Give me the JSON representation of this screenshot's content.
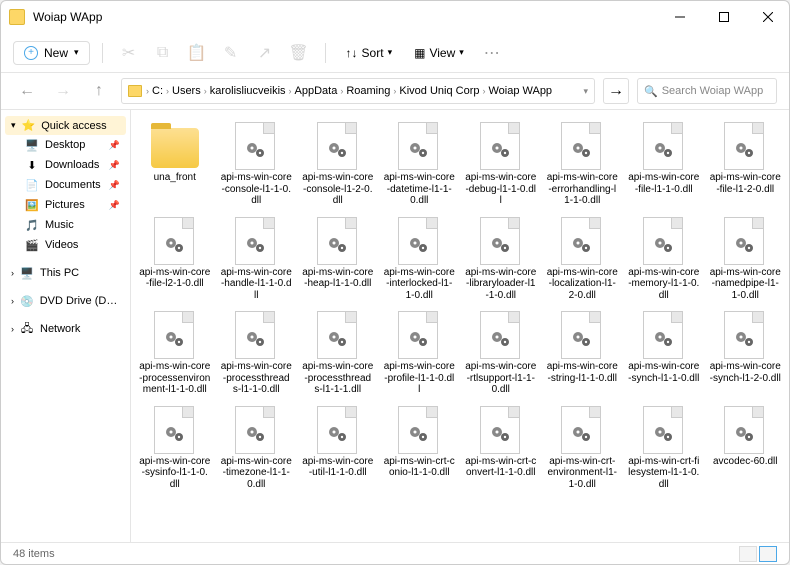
{
  "window": {
    "title": "Woiap WApp"
  },
  "toolbar": {
    "new_label": "New",
    "sort_label": "Sort",
    "view_label": "View"
  },
  "breadcrumbs": [
    "C:",
    "Users",
    "karolisliucveikis",
    "AppData",
    "Roaming",
    "Kivod Uniq Corp",
    "Woiap WApp"
  ],
  "search": {
    "placeholder": "Search Woiap WApp"
  },
  "sidebar": {
    "quick": "Quick access",
    "items": [
      {
        "label": "Desktop",
        "icon": "🖥️",
        "pinned": true
      },
      {
        "label": "Downloads",
        "icon": "⬇",
        "pinned": true
      },
      {
        "label": "Documents",
        "icon": "📄",
        "pinned": true
      },
      {
        "label": "Pictures",
        "icon": "🖼️",
        "pinned": true
      },
      {
        "label": "Music",
        "icon": "🎵",
        "pinned": false
      },
      {
        "label": "Videos",
        "icon": "🎬",
        "pinned": false
      }
    ],
    "thispc": "This PC",
    "dvd": "DVD Drive (D:) CCCC",
    "network": "Network"
  },
  "files": [
    {
      "name": "una_front",
      "type": "folder"
    },
    {
      "name": "api-ms-win-core-console-l1-1-0.dll",
      "type": "dll"
    },
    {
      "name": "api-ms-win-core-console-l1-2-0.dll",
      "type": "dll"
    },
    {
      "name": "api-ms-win-core-datetime-l1-1-0.dll",
      "type": "dll"
    },
    {
      "name": "api-ms-win-core-debug-l1-1-0.dll",
      "type": "dll"
    },
    {
      "name": "api-ms-win-core-errorhandling-l1-1-0.dll",
      "type": "dll"
    },
    {
      "name": "api-ms-win-core-file-l1-1-0.dll",
      "type": "dll"
    },
    {
      "name": "api-ms-win-core-file-l1-2-0.dll",
      "type": "dll"
    },
    {
      "name": "api-ms-win-core-file-l2-1-0.dll",
      "type": "dll"
    },
    {
      "name": "api-ms-win-core-handle-l1-1-0.dll",
      "type": "dll"
    },
    {
      "name": "api-ms-win-core-heap-l1-1-0.dll",
      "type": "dll"
    },
    {
      "name": "api-ms-win-core-interlocked-l1-1-0.dll",
      "type": "dll"
    },
    {
      "name": "api-ms-win-core-libraryloader-l1-1-0.dll",
      "type": "dll"
    },
    {
      "name": "api-ms-win-core-localization-l1-2-0.dll",
      "type": "dll"
    },
    {
      "name": "api-ms-win-core-memory-l1-1-0.dll",
      "type": "dll"
    },
    {
      "name": "api-ms-win-core-namedpipe-l1-1-0.dll",
      "type": "dll"
    },
    {
      "name": "api-ms-win-core-processenvironment-l1-1-0.dll",
      "type": "dll"
    },
    {
      "name": "api-ms-win-core-processthreads-l1-1-0.dll",
      "type": "dll"
    },
    {
      "name": "api-ms-win-core-processthreads-l1-1-1.dll",
      "type": "dll"
    },
    {
      "name": "api-ms-win-core-profile-l1-1-0.dll",
      "type": "dll"
    },
    {
      "name": "api-ms-win-core-rtlsupport-l1-1-0.dll",
      "type": "dll"
    },
    {
      "name": "api-ms-win-core-string-l1-1-0.dll",
      "type": "dll"
    },
    {
      "name": "api-ms-win-core-synch-l1-1-0.dll",
      "type": "dll"
    },
    {
      "name": "api-ms-win-core-synch-l1-2-0.dll",
      "type": "dll"
    },
    {
      "name": "api-ms-win-core-sysinfo-l1-1-0.dll",
      "type": "dll"
    },
    {
      "name": "api-ms-win-core-timezone-l1-1-0.dll",
      "type": "dll"
    },
    {
      "name": "api-ms-win-core-util-l1-1-0.dll",
      "type": "dll"
    },
    {
      "name": "api-ms-win-crt-conio-l1-1-0.dll",
      "type": "dll"
    },
    {
      "name": "api-ms-win-crt-convert-l1-1-0.dll",
      "type": "dll"
    },
    {
      "name": "api-ms-win-crt-environment-l1-1-0.dll",
      "type": "dll"
    },
    {
      "name": "api-ms-win-crt-filesystem-l1-1-0.dll",
      "type": "dll"
    },
    {
      "name": "avcodec-60.dll",
      "type": "dll"
    }
  ],
  "status": {
    "count": "48 items"
  }
}
